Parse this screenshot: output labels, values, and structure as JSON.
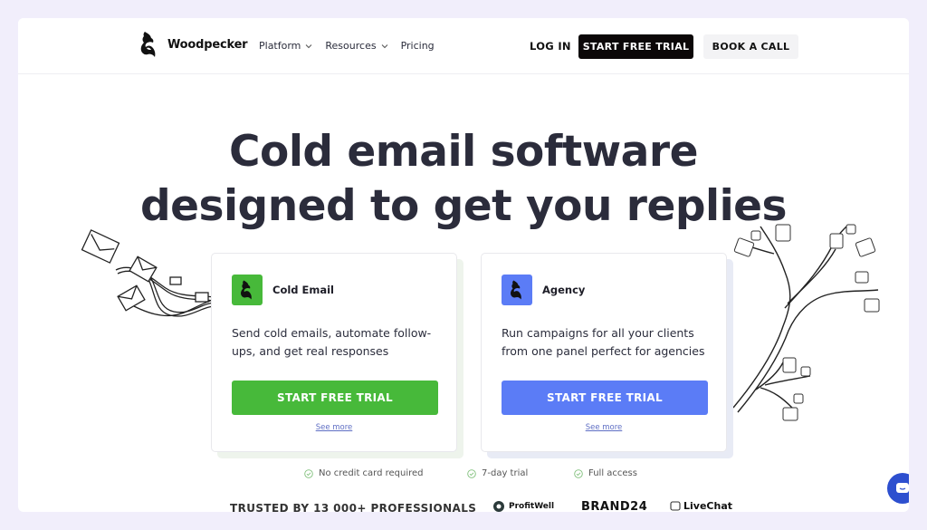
{
  "header": {
    "brand": "Woodpecker",
    "nav": [
      {
        "label": "Platform",
        "has_dropdown": true
      },
      {
        "label": "Resources",
        "has_dropdown": true
      },
      {
        "label": "Pricing",
        "has_dropdown": false
      }
    ],
    "login_label": "LOG IN",
    "start_trial_label": "START FREE TRIAL",
    "book_call_label": "BOOK A CALL"
  },
  "hero": {
    "title_line1": "Cold email software",
    "title_line2": "designed to get you replies"
  },
  "cards": [
    {
      "title": "Cold Email",
      "description": "Send cold emails, automate follow-ups, and get real responses",
      "button_label": "START FREE TRIAL",
      "link_label": "See more",
      "accent": "#47b93a"
    },
    {
      "title": "Agency",
      "description": "Run campaigns for all your clients from one panel perfect for agencies",
      "button_label": "START FREE TRIAL",
      "link_label": "See more",
      "accent": "#5b7cf6"
    }
  ],
  "features": [
    "No credit card required",
    "7-day trial",
    "Full access"
  ],
  "trusted": {
    "label": "TRUSTED BY 13 000+ PROFESSIONALS",
    "brands": [
      "ProfitWell",
      "BRAND24",
      "LiveChat"
    ]
  },
  "colors": {
    "dark_button": "#0b0708",
    "green": "#47b93a",
    "blue": "#5b7cf6",
    "check": "#7fbf7a",
    "chat_widget": "#2d4fcf"
  }
}
